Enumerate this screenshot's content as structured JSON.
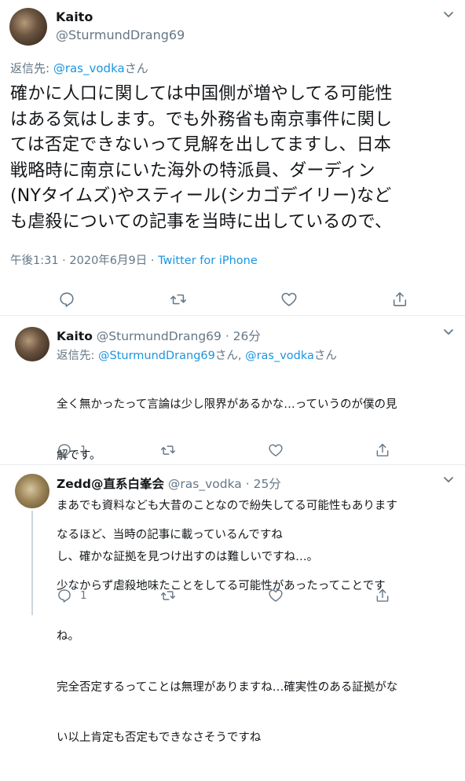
{
  "main_tweet": {
    "name": "Kaito",
    "handle": "@SturmundDrang69",
    "reply_prefix": "返信先: ",
    "reply_target": "@ras_vodka",
    "reply_suffix": "さん",
    "text_lines": [
      "確かに人口に関しては中国側が増やしてる可能性",
      "はある気はします。でも外務省も南京事件に関し",
      "ては否定できないって見解を出してますし、日本",
      "戦略時に南京にいた海外の特派員、ダーディン",
      "(NYタイムズ)やスティール(シカゴデイリー)など",
      "も虐殺についての記事を当時に出しているので、"
    ],
    "meta_time": "午後1:31 · 2020年6月9日 · ",
    "meta_source": "Twitter for iPhone"
  },
  "replies": [
    {
      "name": "Kaito",
      "handle": "@SturmundDrang69",
      "age": " · 26分",
      "reply_prefix": "返信先: ",
      "reply_target_1": "@SturmundDrang69",
      "reply_mid": "さん, ",
      "reply_target_2": "@ras_vodka",
      "reply_suffix": "さん",
      "text_lines": [
        "全く無かったって言論は少し限界があるかな…っていうのが僕の見",
        "解です。",
        "まあでも資料なども大昔のことなので紛失してる可能性もあります",
        "し、確かな証拠を見つけ出すのは難しいですね…。"
      ],
      "reply_count": "1"
    },
    {
      "name": "Zedd@直系白峯会",
      "handle": "@ras_vodka",
      "age": " · 25分",
      "text_lines": [
        "なるほど、当時の記事に載っているんですね",
        "少なからず虐殺地味たことをしてる可能性があったってことです",
        "ね。",
        "完全否定するってことは無理がありますね…確実性のある証拠がな",
        "い以上肯定も否定もできなさそうですね"
      ],
      "reply_count": "1"
    }
  ],
  "icons": {
    "reply": "reply-icon",
    "retweet": "retweet-icon",
    "like": "heart-icon",
    "share": "share-icon",
    "caret": "chevron-down-icon"
  },
  "colors": {
    "link": "#1b95e0",
    "muted": "#657786",
    "text": "#14171a",
    "separator": "#e6ecf0"
  }
}
